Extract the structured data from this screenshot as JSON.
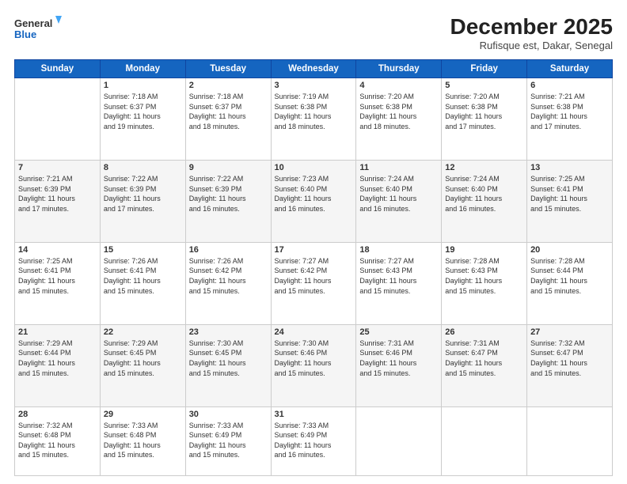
{
  "header": {
    "logo_line1": "General",
    "logo_line2": "Blue",
    "month_title": "December 2025",
    "subtitle": "Rufisque est, Dakar, Senegal"
  },
  "weekdays": [
    "Sunday",
    "Monday",
    "Tuesday",
    "Wednesday",
    "Thursday",
    "Friday",
    "Saturday"
  ],
  "weeks": [
    [
      {
        "day": "",
        "info": ""
      },
      {
        "day": "1",
        "info": "Sunrise: 7:18 AM\nSunset: 6:37 PM\nDaylight: 11 hours\nand 19 minutes."
      },
      {
        "day": "2",
        "info": "Sunrise: 7:18 AM\nSunset: 6:37 PM\nDaylight: 11 hours\nand 18 minutes."
      },
      {
        "day": "3",
        "info": "Sunrise: 7:19 AM\nSunset: 6:38 PM\nDaylight: 11 hours\nand 18 minutes."
      },
      {
        "day": "4",
        "info": "Sunrise: 7:20 AM\nSunset: 6:38 PM\nDaylight: 11 hours\nand 18 minutes."
      },
      {
        "day": "5",
        "info": "Sunrise: 7:20 AM\nSunset: 6:38 PM\nDaylight: 11 hours\nand 17 minutes."
      },
      {
        "day": "6",
        "info": "Sunrise: 7:21 AM\nSunset: 6:38 PM\nDaylight: 11 hours\nand 17 minutes."
      }
    ],
    [
      {
        "day": "7",
        "info": "Sunrise: 7:21 AM\nSunset: 6:39 PM\nDaylight: 11 hours\nand 17 minutes."
      },
      {
        "day": "8",
        "info": "Sunrise: 7:22 AM\nSunset: 6:39 PM\nDaylight: 11 hours\nand 17 minutes."
      },
      {
        "day": "9",
        "info": "Sunrise: 7:22 AM\nSunset: 6:39 PM\nDaylight: 11 hours\nand 16 minutes."
      },
      {
        "day": "10",
        "info": "Sunrise: 7:23 AM\nSunset: 6:40 PM\nDaylight: 11 hours\nand 16 minutes."
      },
      {
        "day": "11",
        "info": "Sunrise: 7:24 AM\nSunset: 6:40 PM\nDaylight: 11 hours\nand 16 minutes."
      },
      {
        "day": "12",
        "info": "Sunrise: 7:24 AM\nSunset: 6:40 PM\nDaylight: 11 hours\nand 16 minutes."
      },
      {
        "day": "13",
        "info": "Sunrise: 7:25 AM\nSunset: 6:41 PM\nDaylight: 11 hours\nand 15 minutes."
      }
    ],
    [
      {
        "day": "14",
        "info": "Sunrise: 7:25 AM\nSunset: 6:41 PM\nDaylight: 11 hours\nand 15 minutes."
      },
      {
        "day": "15",
        "info": "Sunrise: 7:26 AM\nSunset: 6:41 PM\nDaylight: 11 hours\nand 15 minutes."
      },
      {
        "day": "16",
        "info": "Sunrise: 7:26 AM\nSunset: 6:42 PM\nDaylight: 11 hours\nand 15 minutes."
      },
      {
        "day": "17",
        "info": "Sunrise: 7:27 AM\nSunset: 6:42 PM\nDaylight: 11 hours\nand 15 minutes."
      },
      {
        "day": "18",
        "info": "Sunrise: 7:27 AM\nSunset: 6:43 PM\nDaylight: 11 hours\nand 15 minutes."
      },
      {
        "day": "19",
        "info": "Sunrise: 7:28 AM\nSunset: 6:43 PM\nDaylight: 11 hours\nand 15 minutes."
      },
      {
        "day": "20",
        "info": "Sunrise: 7:28 AM\nSunset: 6:44 PM\nDaylight: 11 hours\nand 15 minutes."
      }
    ],
    [
      {
        "day": "21",
        "info": "Sunrise: 7:29 AM\nSunset: 6:44 PM\nDaylight: 11 hours\nand 15 minutes."
      },
      {
        "day": "22",
        "info": "Sunrise: 7:29 AM\nSunset: 6:45 PM\nDaylight: 11 hours\nand 15 minutes."
      },
      {
        "day": "23",
        "info": "Sunrise: 7:30 AM\nSunset: 6:45 PM\nDaylight: 11 hours\nand 15 minutes."
      },
      {
        "day": "24",
        "info": "Sunrise: 7:30 AM\nSunset: 6:46 PM\nDaylight: 11 hours\nand 15 minutes."
      },
      {
        "day": "25",
        "info": "Sunrise: 7:31 AM\nSunset: 6:46 PM\nDaylight: 11 hours\nand 15 minutes."
      },
      {
        "day": "26",
        "info": "Sunrise: 7:31 AM\nSunset: 6:47 PM\nDaylight: 11 hours\nand 15 minutes."
      },
      {
        "day": "27",
        "info": "Sunrise: 7:32 AM\nSunset: 6:47 PM\nDaylight: 11 hours\nand 15 minutes."
      }
    ],
    [
      {
        "day": "28",
        "info": "Sunrise: 7:32 AM\nSunset: 6:48 PM\nDaylight: 11 hours\nand 15 minutes."
      },
      {
        "day": "29",
        "info": "Sunrise: 7:33 AM\nSunset: 6:48 PM\nDaylight: 11 hours\nand 15 minutes."
      },
      {
        "day": "30",
        "info": "Sunrise: 7:33 AM\nSunset: 6:49 PM\nDaylight: 11 hours\nand 15 minutes."
      },
      {
        "day": "31",
        "info": "Sunrise: 7:33 AM\nSunset: 6:49 PM\nDaylight: 11 hours\nand 16 minutes."
      },
      {
        "day": "",
        "info": ""
      },
      {
        "day": "",
        "info": ""
      },
      {
        "day": "",
        "info": ""
      }
    ]
  ]
}
